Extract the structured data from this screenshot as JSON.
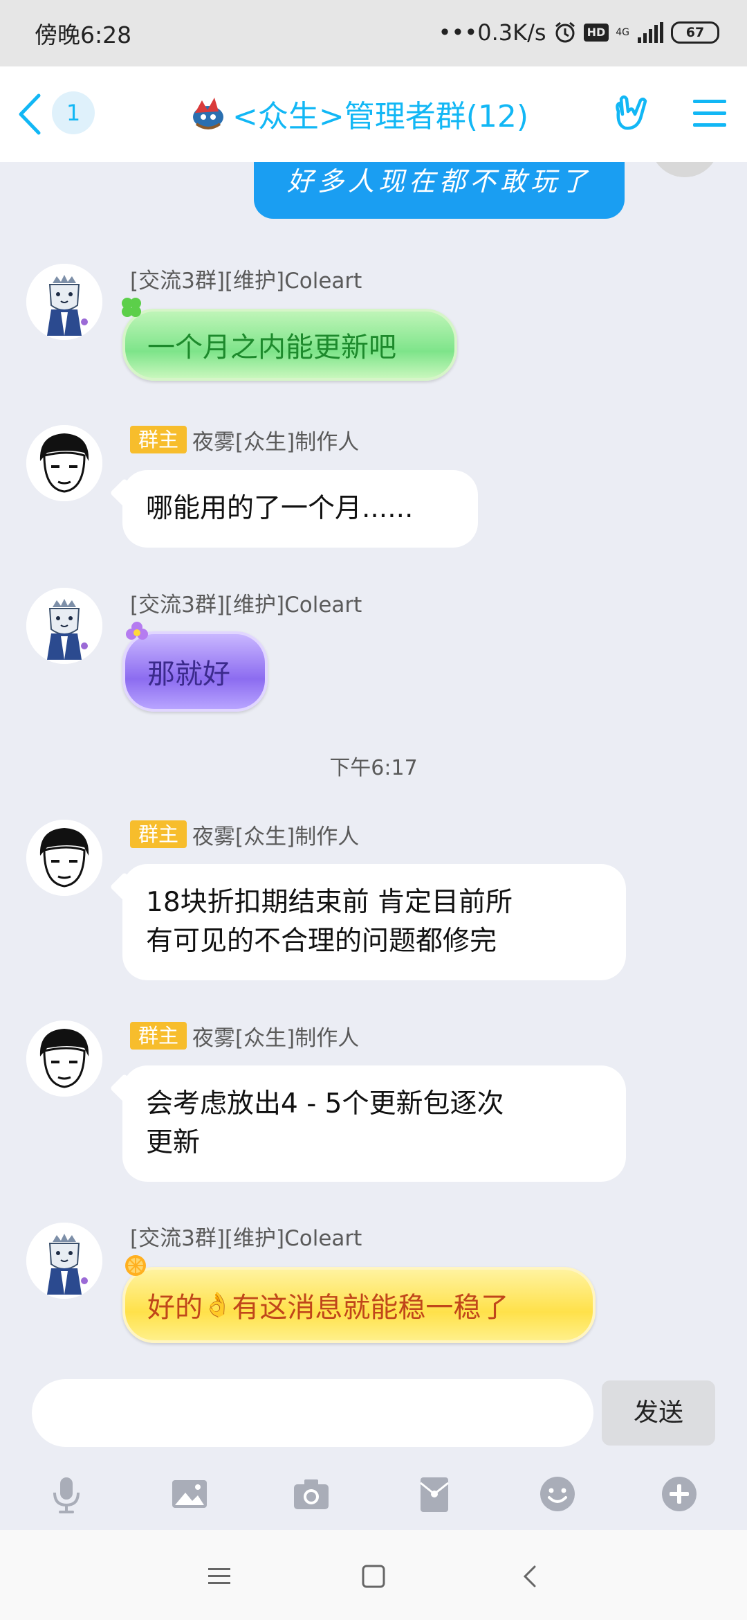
{
  "status_bar": {
    "time": "傍晚6:28",
    "network_speed": "•••0.3K/s",
    "hd_label": "HD",
    "network_type": "4G",
    "battery": "67"
  },
  "header": {
    "unread_count": "1",
    "title": "<众生>管理者群(12)",
    "accent_color": "#12b7f5"
  },
  "messages": {
    "partial_own": {
      "text": "好多人现在都不敢玩了"
    },
    "m1": {
      "sender": "[交流3群][维护]Coleart",
      "text": "一个月之内能更新吧"
    },
    "m2": {
      "role": "群主",
      "sender": "夜雾[众生]制作人",
      "text": "哪能用的了一个月......"
    },
    "m3": {
      "sender": "[交流3群][维护]Coleart",
      "text": "那就好"
    },
    "timestamp": "下午6:17",
    "m4": {
      "role": "群主",
      "sender": "夜雾[众生]制作人",
      "line1": "18块折扣期结束前 肯定目前所",
      "line2": "有可见的不合理的问题都修完"
    },
    "m5": {
      "role": "群主",
      "sender": "夜雾[众生]制作人",
      "line1": "会考虑放出4 - 5个更新包逐次",
      "line2": "更新"
    },
    "m6": {
      "sender": "[交流3群][维护]Coleart",
      "text_before": "好的",
      "emoji": "👌",
      "text_after": "有这消息就能稳一稳了"
    }
  },
  "input": {
    "value": "",
    "send_label": "发送"
  },
  "toolbar": {
    "icons": [
      "microphone-icon",
      "image-icon",
      "camera-icon",
      "red-packet-icon",
      "emoji-icon",
      "plus-icon"
    ]
  }
}
